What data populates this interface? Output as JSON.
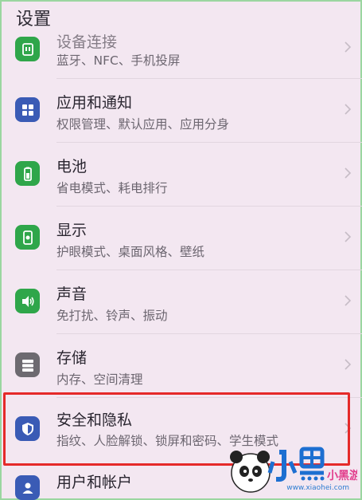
{
  "header": {
    "title": "设置"
  },
  "rows": [
    {
      "title": "设备连接",
      "subtitle": "蓝牙、NFC、手机投屏",
      "icon": "device-connect-icon",
      "color": "#2fa64a"
    },
    {
      "title": "应用和通知",
      "subtitle": "权限管理、默认应用、应用分身",
      "icon": "apps-grid-icon",
      "color": "#3a5bb5"
    },
    {
      "title": "电池",
      "subtitle": "省电模式、耗电排行",
      "icon": "battery-icon",
      "color": "#2fa64a"
    },
    {
      "title": "显示",
      "subtitle": "护眼模式、桌面风格、壁纸",
      "icon": "display-icon",
      "color": "#2fa64a"
    },
    {
      "title": "声音",
      "subtitle": "免打扰、铃声、振动",
      "icon": "speaker-icon",
      "color": "#2fa64a"
    },
    {
      "title": "存储",
      "subtitle": "内存、空间清理",
      "icon": "storage-icon",
      "color": "#6d6a70"
    },
    {
      "title": "安全和隐私",
      "subtitle": "指纹、人脸解锁、锁屏和密码、学生模式",
      "icon": "shield-icon",
      "color": "#3a5bb5"
    },
    {
      "title": "用户和帐户",
      "subtitle": "",
      "icon": "user-icon",
      "color": "#3a5bb5"
    }
  ],
  "watermark": {
    "logo_text": "小黑游戏",
    "url": "www.xiaohei.com"
  }
}
